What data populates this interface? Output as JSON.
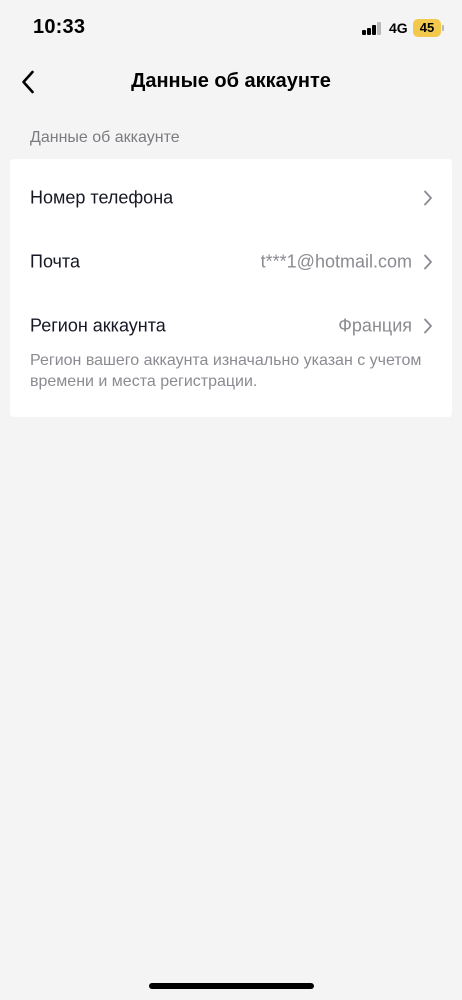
{
  "status_bar": {
    "time": "10:33",
    "network": "4G",
    "battery_level": "45",
    "battery_color": "#f2c94c"
  },
  "nav": {
    "back_icon": "chevron-left-icon",
    "title": "Данные об аккаунте"
  },
  "section": {
    "header": "Данные об аккаунте",
    "rows": [
      {
        "label": "Номер телефона",
        "value": ""
      },
      {
        "label": "Почта",
        "value": "t***1@hotmail.com"
      },
      {
        "label": "Регион аккаунта",
        "value": "Франция"
      }
    ],
    "region_note": "Регион вашего аккаунта изначально указан с учетом времени и места регистрации."
  }
}
